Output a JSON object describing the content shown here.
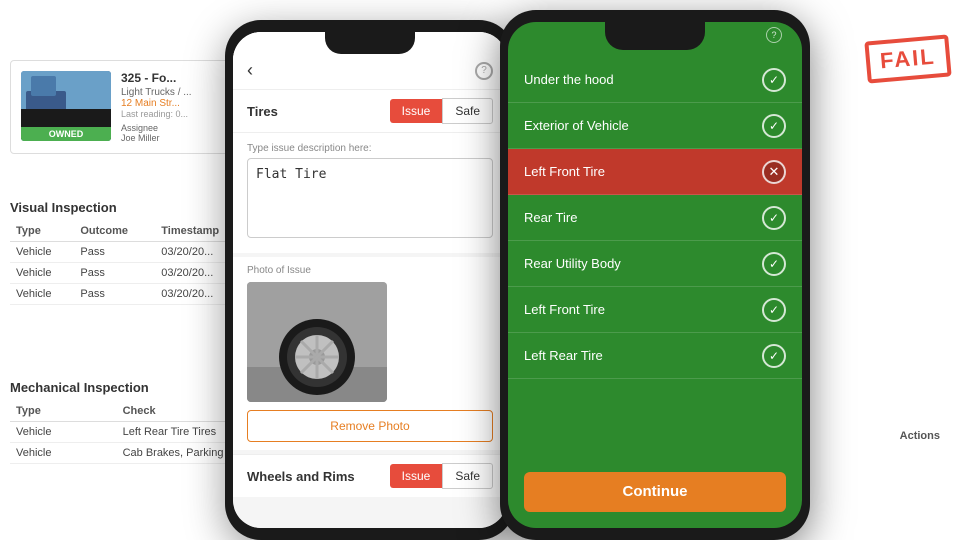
{
  "desktop": {
    "vehicle": {
      "title": "325 - Fo...",
      "subtitle": "Light Trucks / ...",
      "address": "12 Main Str...",
      "last_reading": "Last reading: 0...",
      "assignee_label": "Assignee",
      "assignee": "Joe Miller",
      "owned_badge": "OWNED"
    },
    "visual_inspection": {
      "title": "Visual Inspection",
      "columns": [
        "Type",
        "Outcome",
        "Timestamp"
      ],
      "rows": [
        [
          "Vehicle",
          "Pass",
          "03/20/20..."
        ],
        [
          "Vehicle",
          "Pass",
          "03/20/20..."
        ],
        [
          "Vehicle",
          "Pass",
          "03/20/20..."
        ]
      ]
    },
    "mechanical_inspection": {
      "title": "Mechanical Inspection",
      "columns": [
        "Type",
        "Check"
      ],
      "rows": [
        [
          "Vehicle",
          "Left Rear Tire Tires"
        ],
        [
          "Vehicle",
          "Cab Brakes, Parking"
        ]
      ],
      "actions_label": "Actions"
    }
  },
  "phone1": {
    "back_icon": "‹",
    "help_icon": "?",
    "section": {
      "label": "Tires",
      "issue_btn": "Issue",
      "safe_btn": "Safe"
    },
    "issue_form": {
      "placeholder": "Type issue description here:",
      "value": "Flat Tire"
    },
    "photo": {
      "label": "Photo of Issue",
      "remove_btn": "Remove Photo"
    },
    "section2": {
      "label": "Wheels and Rims",
      "issue_btn": "Issue",
      "safe_btn": "Safe"
    }
  },
  "phone2": {
    "help_icon": "?",
    "inspection_items": [
      {
        "label": "Under the hood",
        "status": "pass"
      },
      {
        "label": "Exterior of Vehicle",
        "status": "pass"
      },
      {
        "label": "Left Front Tire",
        "status": "issue"
      },
      {
        "label": "Rear Tire",
        "status": "pass"
      },
      {
        "label": "Rear Utility Body",
        "status": "pass"
      },
      {
        "label": "Left Front Tire",
        "status": "pass"
      },
      {
        "label": "Left Rear Tire",
        "status": "pass"
      }
    ],
    "continue_btn": "Continue",
    "fail_stamp": "FAIL"
  }
}
